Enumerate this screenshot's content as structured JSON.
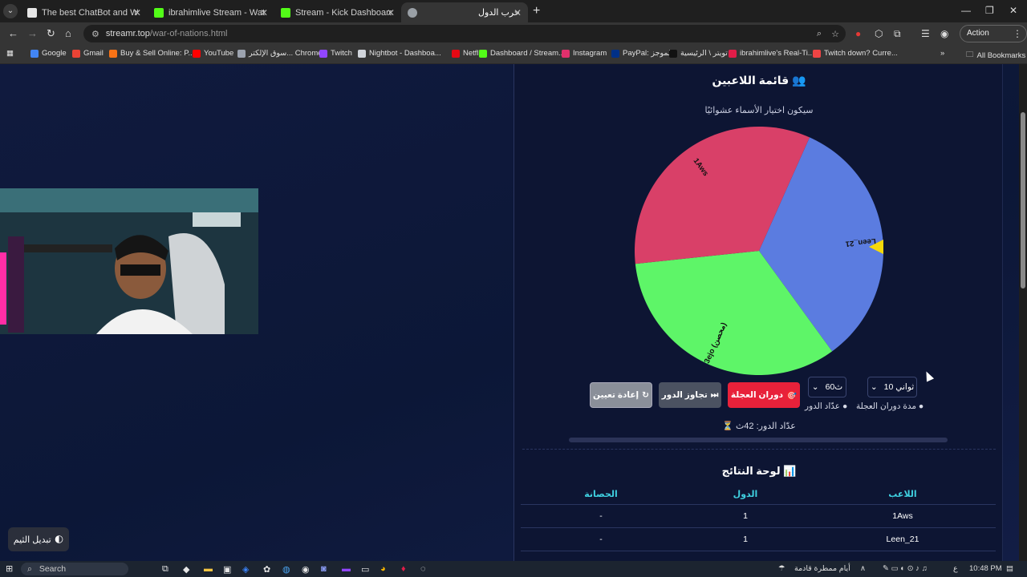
{
  "browser": {
    "tabs": [
      {
        "title": "The best ChatBot and Widgets",
        "favicon": "#e6e6e6",
        "active": false
      },
      {
        "title": "ibrahimlive Stream - Watch Live",
        "favicon": "#53fc18",
        "active": false
      },
      {
        "title": "Stream - Kick Dashboard",
        "favicon": "#53fc18",
        "active": false
      },
      {
        "title": "حرب الدول",
        "favicon": "#9aa0a6",
        "active": true
      }
    ],
    "tab_close_glyph": "✕",
    "new_tab_glyph": "+",
    "url_host": "streamr.top",
    "url_path": "/war-of-nations.html",
    "action_required": "Action required",
    "bookmarks": [
      {
        "label": "Google",
        "color": "#4285f4"
      },
      {
        "label": "Gmail",
        "color": "#ea4335"
      },
      {
        "label": "Buy & Sell Online: P...",
        "color": "#f97316"
      },
      {
        "label": "YouTube",
        "color": "#ff0000"
      },
      {
        "label": "سوق الإلكتر... Chrome",
        "color": "#9ca3af"
      },
      {
        "label": "Twitch",
        "color": "#9146ff"
      },
      {
        "label": "Nightbot - Dashboa...",
        "color": "#d1d5db"
      },
      {
        "label": "Netflix",
        "color": "#e50914"
      },
      {
        "label": "Dashboard / Stream...",
        "color": "#53fc18"
      },
      {
        "label": "Instagram",
        "color": "#e1306c"
      },
      {
        "label": "PayPal: الموجز",
        "color": "#003087"
      },
      {
        "label": "تويتر \\ الرئيسية",
        "color": "#111111"
      },
      {
        "label": "ibrahimlive's Real-Ti...",
        "color": "#e11d48"
      },
      {
        "label": "Twitch down? Curre...",
        "color": "#ef4444"
      }
    ],
    "all_bookmarks": "All Bookmarks"
  },
  "game": {
    "players_title": "قائمة اللاعبين",
    "players_icon": "👥",
    "random_note": "سيكون اختيار الأسماء عشوائيًا",
    "wheel": {
      "segments": [
        {
          "label": "Leen_21",
          "color": "#5b7ce0"
        },
        {
          "label": "3ejo (محصن)",
          "color": "#5ef568"
        },
        {
          "label": "1Aws",
          "color": "#d94068"
        }
      ],
      "pointer_color": "#f5d90a"
    },
    "controls": {
      "spin_label": "دوران العجلة",
      "spin_icon": "🎯",
      "skip_label": "تجاوز الدور",
      "skip_icon": "⏭",
      "reset_label": "إعادة تعيين",
      "reset_icon": "↻",
      "turn_timer_value": "60ث",
      "spin_duration_value": "10 ثواني",
      "turn_timer_label": "عدّاد الدور",
      "spin_duration_label": "مدة دوران العجلة"
    },
    "turn_counter": "⏳ عدّاد الدور: 42ث",
    "results_title": "لوحة النتائج",
    "results_icon": "📊",
    "table": {
      "headers": [
        "اللاعب",
        "الدول",
        "الحصانة"
      ],
      "rows": [
        {
          "player": "1Aws",
          "countries": "1",
          "immunity": "-"
        },
        {
          "player": "Leen_21",
          "countries": "1",
          "immunity": "-"
        }
      ]
    },
    "theme_toggle": "تبديل الثيم",
    "theme_icon": "🌓"
  },
  "taskbar": {
    "search": "Search",
    "weather": "أيام ممطرة قادمة",
    "lang": "ع",
    "time": "10:48 PM"
  }
}
